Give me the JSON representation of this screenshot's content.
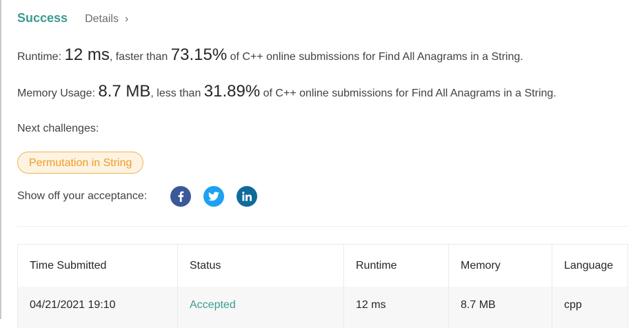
{
  "header": {
    "status_title": "Success",
    "details_link": "Details",
    "details_chevron": "›"
  },
  "runtime": {
    "label": "Runtime: ",
    "value": "12 ms",
    "comparison": ", faster than ",
    "percent": "73.15%",
    "suffix": " of C++ online submissions for Find All Anagrams in a String."
  },
  "memory": {
    "label": "Memory Usage: ",
    "value": "8.7 MB",
    "comparison": ", less than ",
    "percent": "31.89%",
    "suffix": " of C++ online submissions for Find All Anagrams in a String."
  },
  "next_challenges": {
    "label": "Next challenges:",
    "items": [
      "Permutation in String"
    ]
  },
  "share": {
    "label": "Show off your acceptance:",
    "icons": [
      "facebook-icon",
      "twitter-icon",
      "linkedin-icon"
    ],
    "colors": {
      "facebook": "#3b5998",
      "twitter": "#1da1f2",
      "linkedin": "#0e6b9a"
    }
  },
  "submissions": {
    "headers": [
      "Time Submitted",
      "Status",
      "Runtime",
      "Memory",
      "Language"
    ],
    "rows": [
      {
        "time": "04/21/2021 19:10",
        "status": "Accepted",
        "runtime": "12 ms",
        "memory": "8.7 MB",
        "language": "cpp"
      }
    ]
  },
  "colors": {
    "success": "#3a9c8f",
    "tag_text": "#f09c28",
    "tag_border": "#f0b45a",
    "tag_bg": "#fdf3e0"
  }
}
